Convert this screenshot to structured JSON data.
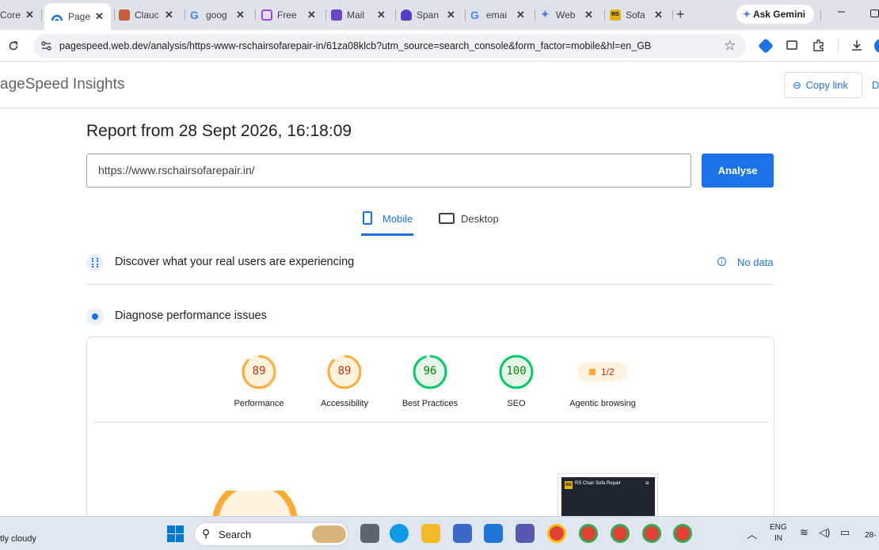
{
  "browser": {
    "tabs": [
      {
        "label": "Core",
        "favicon": "core-icon",
        "color": "#4285f4"
      },
      {
        "label": "Page",
        "favicon": "pagespeed-icon",
        "color": "#1a73e8",
        "active": true
      },
      {
        "label": "Clauc",
        "favicon": "claude-icon",
        "color": "#c15f3c"
      },
      {
        "label": "goog",
        "favicon": "google-icon",
        "color": "#4285f4"
      },
      {
        "label": "Free",
        "favicon": "cube-icon",
        "color": "#a142f4"
      },
      {
        "label": "Mail",
        "favicon": "mail-icon",
        "color": "#6b46c1"
      },
      {
        "label": "Span",
        "favicon": "spam-icon",
        "color": "#5b3cc4"
      },
      {
        "label": "emai",
        "favicon": "google-icon",
        "color": "#4285f4"
      },
      {
        "label": "Web",
        "favicon": "gemini-icon",
        "color": "#4f7bf7"
      },
      {
        "label": "Sofa",
        "favicon": "rs-icon",
        "color": "#e8b100"
      }
    ],
    "ask_gemini": "Ask Gemini",
    "url": "pagespeed.web.dev/analysis/https-www-rschairsofarepair-in/61za08klcb?utm_source=search_console&form_factor=mobile&hl=en_GB"
  },
  "psi": {
    "app_title": "ageSpeed Insights",
    "copy_link": "Copy link",
    "header_cut": "D",
    "report_title": "Report from 28 Sept 2026, 16:18:09",
    "url_value": "https://www.rschairsofarepair.in/",
    "analyse": "Analyse",
    "tabs": {
      "mobile": "Mobile",
      "desktop": "Desktop"
    },
    "real_users": "Discover what your real users are experiencing",
    "no_data": "No data",
    "diagnose": "Diagnose performance issues",
    "scores": [
      {
        "label": "Performance",
        "value": "89",
        "percent": 89,
        "color": "#fa3",
        "text_color": "#c33300",
        "fill": "#fff3e0"
      },
      {
        "label": "Accessibility",
        "value": "89",
        "percent": 89,
        "color": "#fa3",
        "text_color": "#c33300",
        "fill": "#fff3e0"
      },
      {
        "label": "Best Practices",
        "value": "96",
        "percent": 96,
        "color": "#0c6",
        "text_color": "#008800",
        "fill": "#e6f4ea"
      },
      {
        "label": "SEO",
        "value": "100",
        "percent": 100,
        "color": "#0c6",
        "text_color": "#008800",
        "fill": "#e6f4ea"
      }
    ],
    "agentic": {
      "label": "Agentic browsing",
      "value": "1/2"
    },
    "preview_title": "RS Chair Sofa Repair",
    "preview_logo": "RS"
  },
  "taskbar": {
    "weather": "tly cloudy",
    "search": "Search",
    "lang": "ENG",
    "region": "IN",
    "clock": "28-"
  }
}
